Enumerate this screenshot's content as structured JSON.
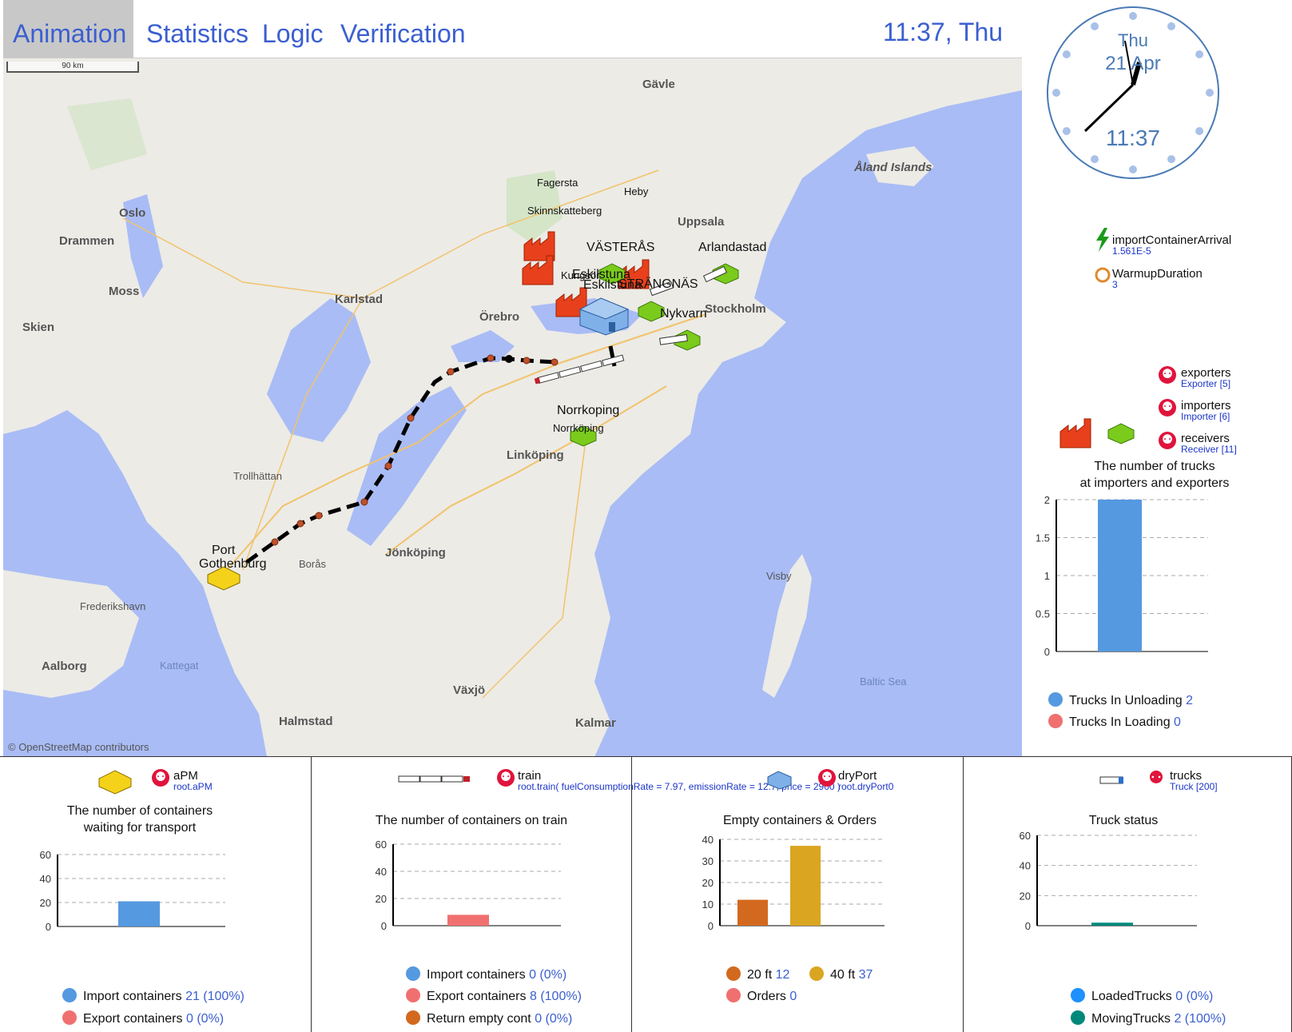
{
  "tabs": [
    "Animation",
    "Statistics",
    "Logic",
    "Verification"
  ],
  "clock_text": "11:37, Thu",
  "analog_clock": {
    "day": "Thu",
    "date": "21 Apr",
    "time": "11:37"
  },
  "map": {
    "scale_label": "90 km",
    "attribution": "© OpenStreetMap contributors",
    "cities": {
      "gavle": "Gävle",
      "aland": "Åland Islands",
      "oslo": "Oslo",
      "drammen": "Drammen",
      "moss": "Moss",
      "skien": "Skien",
      "karlstad": "Karlstad",
      "orebro": "Örebro",
      "uppsala": "Uppsala",
      "stockholm": "Stockholm",
      "linkoping": "Linköping",
      "trollhattan": "Trollhättan",
      "boras": "Borås",
      "jonkoping": "Jönköping",
      "visby": "Visby",
      "frederikshavn": "Frederikshavn",
      "aalborg": "Aalborg",
      "kattegat": "Kattegat",
      "baltic": "Baltic Sea",
      "vaxjo": "Växjö",
      "halmstad": "Halmstad",
      "kalmar": "Kalmar"
    },
    "nodes": {
      "fagersta": "Fagersta",
      "skinnskatteberg": "Skinnskatteberg",
      "heby": "Heby",
      "vasteras": "VÄSTERÅS",
      "arlandastad": "Arlandastad",
      "eskilstuna": "Eskilstuna",
      "kungsor": "Kungsör",
      "eskilstuna2": "Eskilstuna",
      "strangnas": "STRÄNGNÄS",
      "nykvarn": "Nykvarn",
      "norrkoping": "Norrkoping",
      "norrkoping2": "Norrköping",
      "port": "Port",
      "gothenburg": "Gothenburg"
    }
  },
  "events": [
    {
      "name": "importContainerArrival",
      "value": "1.561E-5"
    },
    {
      "name": "WarmupDuration",
      "value": "3"
    }
  ],
  "populations": [
    {
      "name": "exporters",
      "value": "Exporter [5]"
    },
    {
      "name": "importers",
      "value": "Importer [6]"
    },
    {
      "name": "receivers",
      "value": "Receiver [11]"
    }
  ],
  "trucks_chart": {
    "title_line1": "The number of trucks",
    "title_line2": "at importers and exporters",
    "legend": [
      {
        "label": "Trucks In Unloading",
        "value": "2"
      },
      {
        "label": "Trucks In Loading",
        "value": "0"
      }
    ]
  },
  "panels": {
    "apm": {
      "agent": "aPM",
      "agent_sub": "root.aPM",
      "title_line1": "The number of containers",
      "title_line2": "waiting for transport",
      "legend": [
        {
          "label": "Import containers",
          "value": "21 (100%)"
        },
        {
          "label": "Export containers",
          "value": "0 (0%)"
        }
      ]
    },
    "train": {
      "agent": "train",
      "agent_sub": "root.train( fuelConsumptionRate = 7.97, emissionRate = 12.7, price = 2900 )",
      "title": "The number of containers on train",
      "legend": [
        {
          "label": "Import containers",
          "value": "0 (0%)"
        },
        {
          "label": "Export containers",
          "value": "8 (100%)"
        },
        {
          "label": "Return empty cont",
          "value": "0 (0%)"
        }
      ]
    },
    "dryport": {
      "agent": "dryPort",
      "agent_sub": "root.dryPort0",
      "title": "Empty containers & Orders",
      "legend": [
        {
          "label": "20 ft",
          "value": "12"
        },
        {
          "label": "40 ft",
          "value": "37"
        },
        {
          "label": "Orders",
          "value": "0"
        }
      ]
    },
    "trucks": {
      "agent": "trucks",
      "agent_sub": "Truck [200]",
      "title": "Truck status",
      "legend": [
        {
          "label": "LoadedTrucks",
          "value": "0 (0%)"
        },
        {
          "label": "MovingTrucks",
          "value": "2 (100%)"
        }
      ]
    }
  },
  "chart_data": [
    {
      "type": "bar",
      "title": "The number of trucks at importers and exporters",
      "series": [
        {
          "name": "Trucks In Unloading",
          "values": [
            2
          ],
          "color": "#5599e0"
        },
        {
          "name": "Trucks In Loading",
          "values": [
            0
          ],
          "color": "#f07070"
        }
      ],
      "ylim": [
        0,
        2
      ],
      "yticks": [
        "0",
        "0.5",
        "1",
        "1.5",
        "2"
      ]
    },
    {
      "type": "bar",
      "title": "The number of containers waiting for transport",
      "series": [
        {
          "name": "Import containers",
          "values": [
            21
          ],
          "color": "#5599e0"
        },
        {
          "name": "Export containers",
          "values": [
            0
          ],
          "color": "#f07070"
        }
      ],
      "ylim": [
        0,
        60
      ],
      "yticks": [
        "0",
        "20",
        "40",
        "60"
      ]
    },
    {
      "type": "bar",
      "title": "The number of containers on train",
      "series": [
        {
          "name": "Import containers",
          "values": [
            0
          ],
          "color": "#5599e0"
        },
        {
          "name": "Export containers",
          "values": [
            8
          ],
          "color": "#f07070"
        },
        {
          "name": "Return empty cont",
          "values": [
            0
          ],
          "color": "#d2691e"
        }
      ],
      "ylim": [
        0,
        60
      ],
      "yticks": [
        "0",
        "20",
        "40",
        "60"
      ]
    },
    {
      "type": "bar",
      "title": "Empty containers & Orders",
      "series": [
        {
          "name": "20 ft",
          "values": [
            12
          ],
          "color": "#d2691e"
        },
        {
          "name": "40 ft",
          "values": [
            37
          ],
          "color": "#daa520"
        },
        {
          "name": "Orders",
          "values": [
            0
          ],
          "color": "#f07070"
        }
      ],
      "ylim": [
        0,
        40
      ],
      "yticks": [
        "0",
        "10",
        "20",
        "30",
        "40"
      ]
    },
    {
      "type": "bar",
      "title": "Truck status",
      "series": [
        {
          "name": "LoadedTrucks",
          "values": [
            0
          ],
          "color": "#1e90ff"
        },
        {
          "name": "MovingTrucks",
          "values": [
            2
          ],
          "color": "#00897b"
        }
      ],
      "ylim": [
        0,
        60
      ],
      "yticks": [
        "0",
        "20",
        "40",
        "60"
      ]
    }
  ]
}
